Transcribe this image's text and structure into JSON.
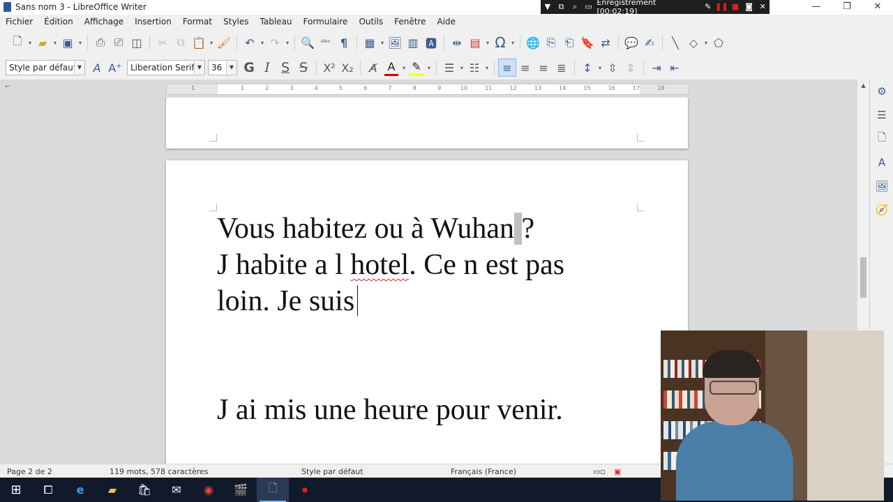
{
  "window": {
    "title": "Sans nom 3 - LibreOffice Writer",
    "minimize": "—",
    "maximize": "❐",
    "close": "✕"
  },
  "recorder": {
    "label": "Enregistrement [00:02:19]"
  },
  "menu": [
    "Fichier",
    "Édition",
    "Affichage",
    "Insertion",
    "Format",
    "Styles",
    "Tableau",
    "Formulaire",
    "Outils",
    "Fenêtre",
    "Aide"
  ],
  "format_toolbar": {
    "paragraph_style": "Style par défaut",
    "font_name": "Liberation Serif",
    "font_size": "36"
  },
  "ruler": {
    "ticks": [
      "1",
      "1",
      "2",
      "3",
      "4",
      "5",
      "6",
      "7",
      "8",
      "9",
      "10",
      "11",
      "12",
      "13",
      "14",
      "15",
      "16",
      "17",
      "18"
    ]
  },
  "document": {
    "line1": "Vous habitez ou à Wuhan",
    "line1_end": "?",
    "line2_start": "J habite a l ",
    "line2_misspelled": "hotel",
    "line2_end": ". Ce n est pas",
    "line3": "loin. Je suis",
    "line4": "J ai mis une heure pour venir."
  },
  "status": {
    "page": "Page 2 de 2",
    "words": "119 mots, 578 caractères",
    "style": "Style par défaut",
    "language": "Français (France)"
  },
  "colors": {
    "accent": "#3a5b8c",
    "highlight": "#cde1f7",
    "taskbar": "#101a2a"
  }
}
